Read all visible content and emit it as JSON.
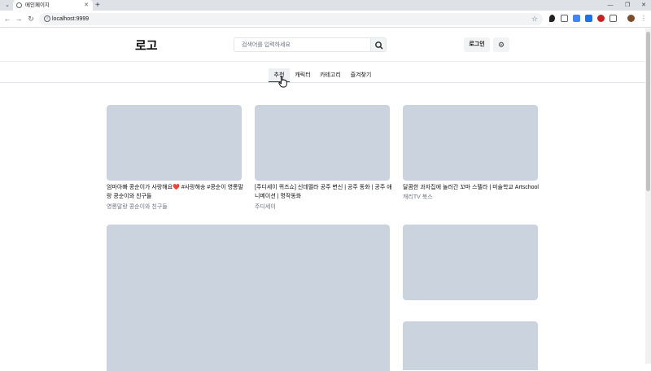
{
  "browser": {
    "tab_title": "메인페이지",
    "url": "localhost:9999"
  },
  "header": {
    "logo": "로고",
    "search_placeholder": "검색어를 입력하세요",
    "login_label": "로그인"
  },
  "nav": {
    "tabs": [
      {
        "label": "추천",
        "active": true
      },
      {
        "label": "캐릭터",
        "active": false
      },
      {
        "label": "카테고리",
        "active": false
      },
      {
        "label": "즐겨찾기",
        "active": false
      }
    ]
  },
  "videos": [
    {
      "title_line1": "엄마아빠 콩순이가 사랑해요❤️ #사랑해송 #콩순이 영롱말",
      "title_line2": "랑 콩순이와 친구들",
      "channel": "영롱말랑 콩순이와 친구들"
    },
    {
      "title_line1": "[주디세이 퀴즈쇼] 신데렐라 공주 변신 | 공주 동화 | 공주 애",
      "title_line2": "니메이션 | 명작동화",
      "channel": "주디세이"
    },
    {
      "title_line1": "달콤한 과자집에 놀러간 꼬마 스텔라 | 미술학교 Artschool",
      "title_line2": "",
      "channel": "캐리TV 북스"
    }
  ],
  "colors": {
    "thumbnail_placeholder": "#cbd4de",
    "button_bg": "#f1f3f5",
    "active_tab_bg": "#eef0f3"
  },
  "icons": {
    "search": "search-icon",
    "settings": "gear-icon"
  }
}
